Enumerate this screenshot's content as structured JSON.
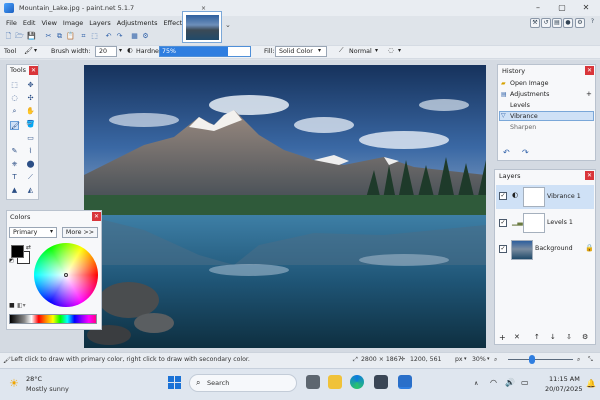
{
  "window": {
    "title": "Mountain_Lake.jpg - paint.net 5.1.7"
  },
  "menu": [
    "File",
    "Edit",
    "View",
    "Image",
    "Layers",
    "Adjustments",
    "Effects"
  ],
  "image_tab": {
    "close": "×",
    "dropdown": "⌄"
  },
  "options": {
    "tool_label": "Tool",
    "brush_width_label": "Brush width:",
    "brush_width_value": "20",
    "hardness_label": "Hardness:",
    "hardness_value": "75%",
    "hardness_fraction": 0.75,
    "fill_label": "Fill:",
    "fill_value": "Solid Color",
    "blend_value": "Normal"
  },
  "tools_panel": {
    "title": "Tools"
  },
  "colors_panel": {
    "title": "Colors",
    "mode": "Primary",
    "more_button": "More >>"
  },
  "history_panel": {
    "title": "History",
    "items": [
      "Open Image",
      "Adjustments",
      "Levels",
      "Vibrance",
      "Sharpen"
    ]
  },
  "layers_panel": {
    "title": "Layers",
    "layers": [
      "Vibrance 1",
      "Levels 1",
      "Background"
    ]
  },
  "status": {
    "hint": "Left click to draw with primary color, right click to draw with secondary color.",
    "image_size": "2800 × 1867",
    "cursor": "1200, 561",
    "units": "px",
    "zoom": "30%"
  },
  "taskbar": {
    "weather_temp": "28°C",
    "weather_desc": "Mostly sunny",
    "search_label": "Search",
    "time": "11:15 AM",
    "date": "20/07/2025"
  },
  "colors": {
    "accent": "#2f7ee0",
    "close_red": "#d9353a",
    "primary_color": "#000000",
    "secondary_color": "#ffffff"
  }
}
